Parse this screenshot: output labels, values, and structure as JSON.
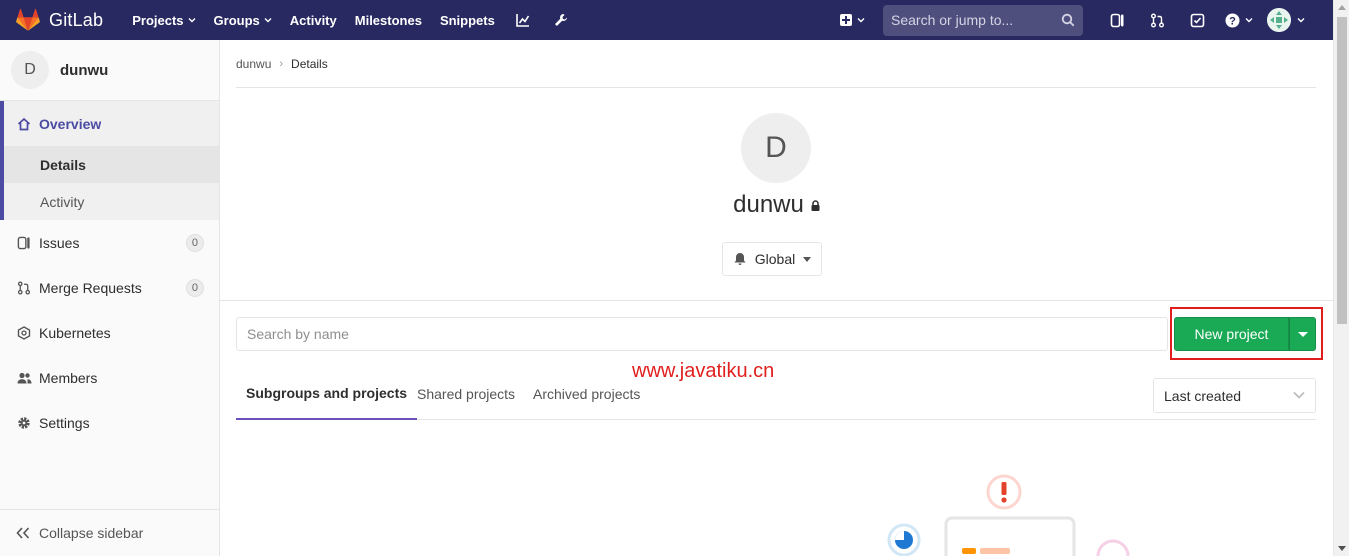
{
  "navbar": {
    "brand": "GitLab",
    "links": [
      {
        "label": "Projects",
        "dropdown": true
      },
      {
        "label": "Groups",
        "dropdown": true
      },
      {
        "label": "Activity",
        "dropdown": false
      },
      {
        "label": "Milestones",
        "dropdown": false
      },
      {
        "label": "Snippets",
        "dropdown": false
      }
    ],
    "search_placeholder": "Search or jump to...",
    "icons": [
      "chart-icon",
      "wrench-icon",
      "plus-square-icon",
      "search-icon",
      "issues-icon",
      "merge-request-icon",
      "todo-icon",
      "help-icon",
      "avatar"
    ],
    "colors": {
      "background": "#292961"
    }
  },
  "sidebar": {
    "context_avatar": "D",
    "context_name": "dunwu",
    "overview_label": "Overview",
    "sub_items": [
      {
        "label": "Details",
        "active": true
      },
      {
        "label": "Activity",
        "active": false
      }
    ],
    "items": [
      {
        "label": "Issues",
        "icon": "issues-icon",
        "count": "0"
      },
      {
        "label": "Merge Requests",
        "icon": "merge-request-icon",
        "count": "0"
      },
      {
        "label": "Kubernetes",
        "icon": "kubernetes-icon",
        "count": null
      },
      {
        "label": "Members",
        "icon": "members-icon",
        "count": null
      },
      {
        "label": "Settings",
        "icon": "settings-icon",
        "count": null
      }
    ],
    "collapse_label": "Collapse sidebar"
  },
  "breadcrumb": {
    "parent": "dunwu",
    "current": "Details"
  },
  "group": {
    "avatar_letter": "D",
    "name": "dunwu",
    "visibility_icon": "lock-icon",
    "notification_level": "Global"
  },
  "filter": {
    "placeholder": "Search by name",
    "new_project_label": "New project",
    "accent": "#1aaa55"
  },
  "watermark": "www.javatiku.cn",
  "tabs": {
    "items": [
      "Subgroups and projects",
      "Shared projects",
      "Archived projects"
    ],
    "active": "Subgroups and projects"
  },
  "sort": {
    "selected": "Last created"
  }
}
